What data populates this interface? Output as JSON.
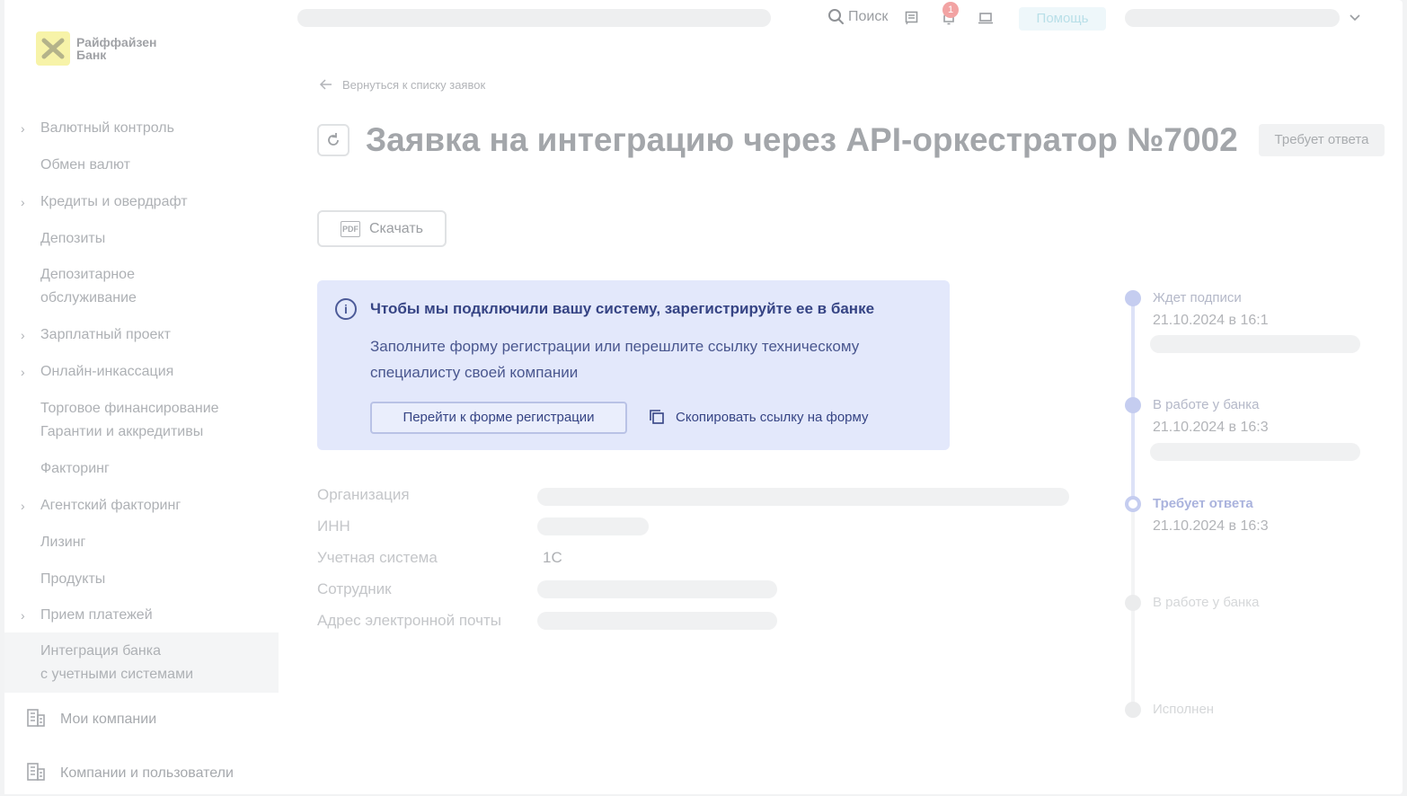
{
  "brand": {
    "name_line1": "Райффайзен",
    "name_line2": "Банк"
  },
  "header": {
    "search_label": "Поиск",
    "notifications_count": "1",
    "help_label": "Помощь"
  },
  "sidebar": {
    "items": [
      {
        "label": "Валютный контроль",
        "expandable": true
      },
      {
        "label": "Обмен валют",
        "expandable": false
      },
      {
        "label": "Кредиты и овердрафт",
        "expandable": true
      },
      {
        "label": "Депозиты",
        "expandable": false
      },
      {
        "label_line1": "Депозитарное",
        "label_line2": "обслуживание",
        "expandable": false
      },
      {
        "label": "Зарплатный проект",
        "expandable": true
      },
      {
        "label": "Онлайн-инкассация",
        "expandable": true
      },
      {
        "label_line1": "Торговое финансирование",
        "label_line2": "Гарантии и аккредитивы",
        "expandable": false
      },
      {
        "label": "Факторинг",
        "expandable": false
      },
      {
        "label": "Агентский факторинг",
        "expandable": true
      },
      {
        "label": "Лизинг",
        "expandable": false
      },
      {
        "label": "Продукты",
        "expandable": false
      },
      {
        "label": "Прием платежей",
        "expandable": true
      },
      {
        "label_line1": "Интеграция банка",
        "label_line2": "с учетными системами",
        "active": true
      }
    ],
    "bottom": [
      {
        "label": "Мои компании",
        "icon": "building-icon"
      },
      {
        "label": "Компании и пользователи",
        "icon": "building-icon"
      }
    ]
  },
  "main": {
    "back_label": "Вернуться к списку заявок",
    "title": "Заявка на интеграцию через API-оркестратор №7002",
    "status": "Требует ответа",
    "download_label": "Скачать",
    "download_icon_text": "PDF",
    "info": {
      "title": "Чтобы мы подключили вашу систему, зарегистрируйте ее в банке",
      "text": "Заполните форму регистрации или перешлите ссылку техническому специалисту своей компании",
      "primary_button": "Перейти к форме регистрации",
      "copy_link": "Скопировать ссылку на форму",
      "accent_color": "#364484",
      "background_color": "#e3e8fb"
    },
    "fields": [
      {
        "label": "Организация",
        "value": null
      },
      {
        "label": "ИНН",
        "value": null
      },
      {
        "label": "Учетная система",
        "value": "1С"
      },
      {
        "label": "Сотрудник",
        "value": null
      },
      {
        "label": "Адрес электронной почты",
        "value": null
      }
    ]
  },
  "timeline": [
    {
      "label": "Ждет подписи",
      "date": "21.10.2024 в 16:1",
      "state": "done"
    },
    {
      "label": "В работе у банка",
      "date": "21.10.2024 в 16:3",
      "state": "done"
    },
    {
      "label": "Требует ответа",
      "date": "21.10.2024 в 16:3",
      "state": "current"
    },
    {
      "label": "В работе у банка",
      "date": null,
      "state": "pending"
    },
    {
      "label": "Исполнен",
      "date": null,
      "state": "pending"
    }
  ]
}
